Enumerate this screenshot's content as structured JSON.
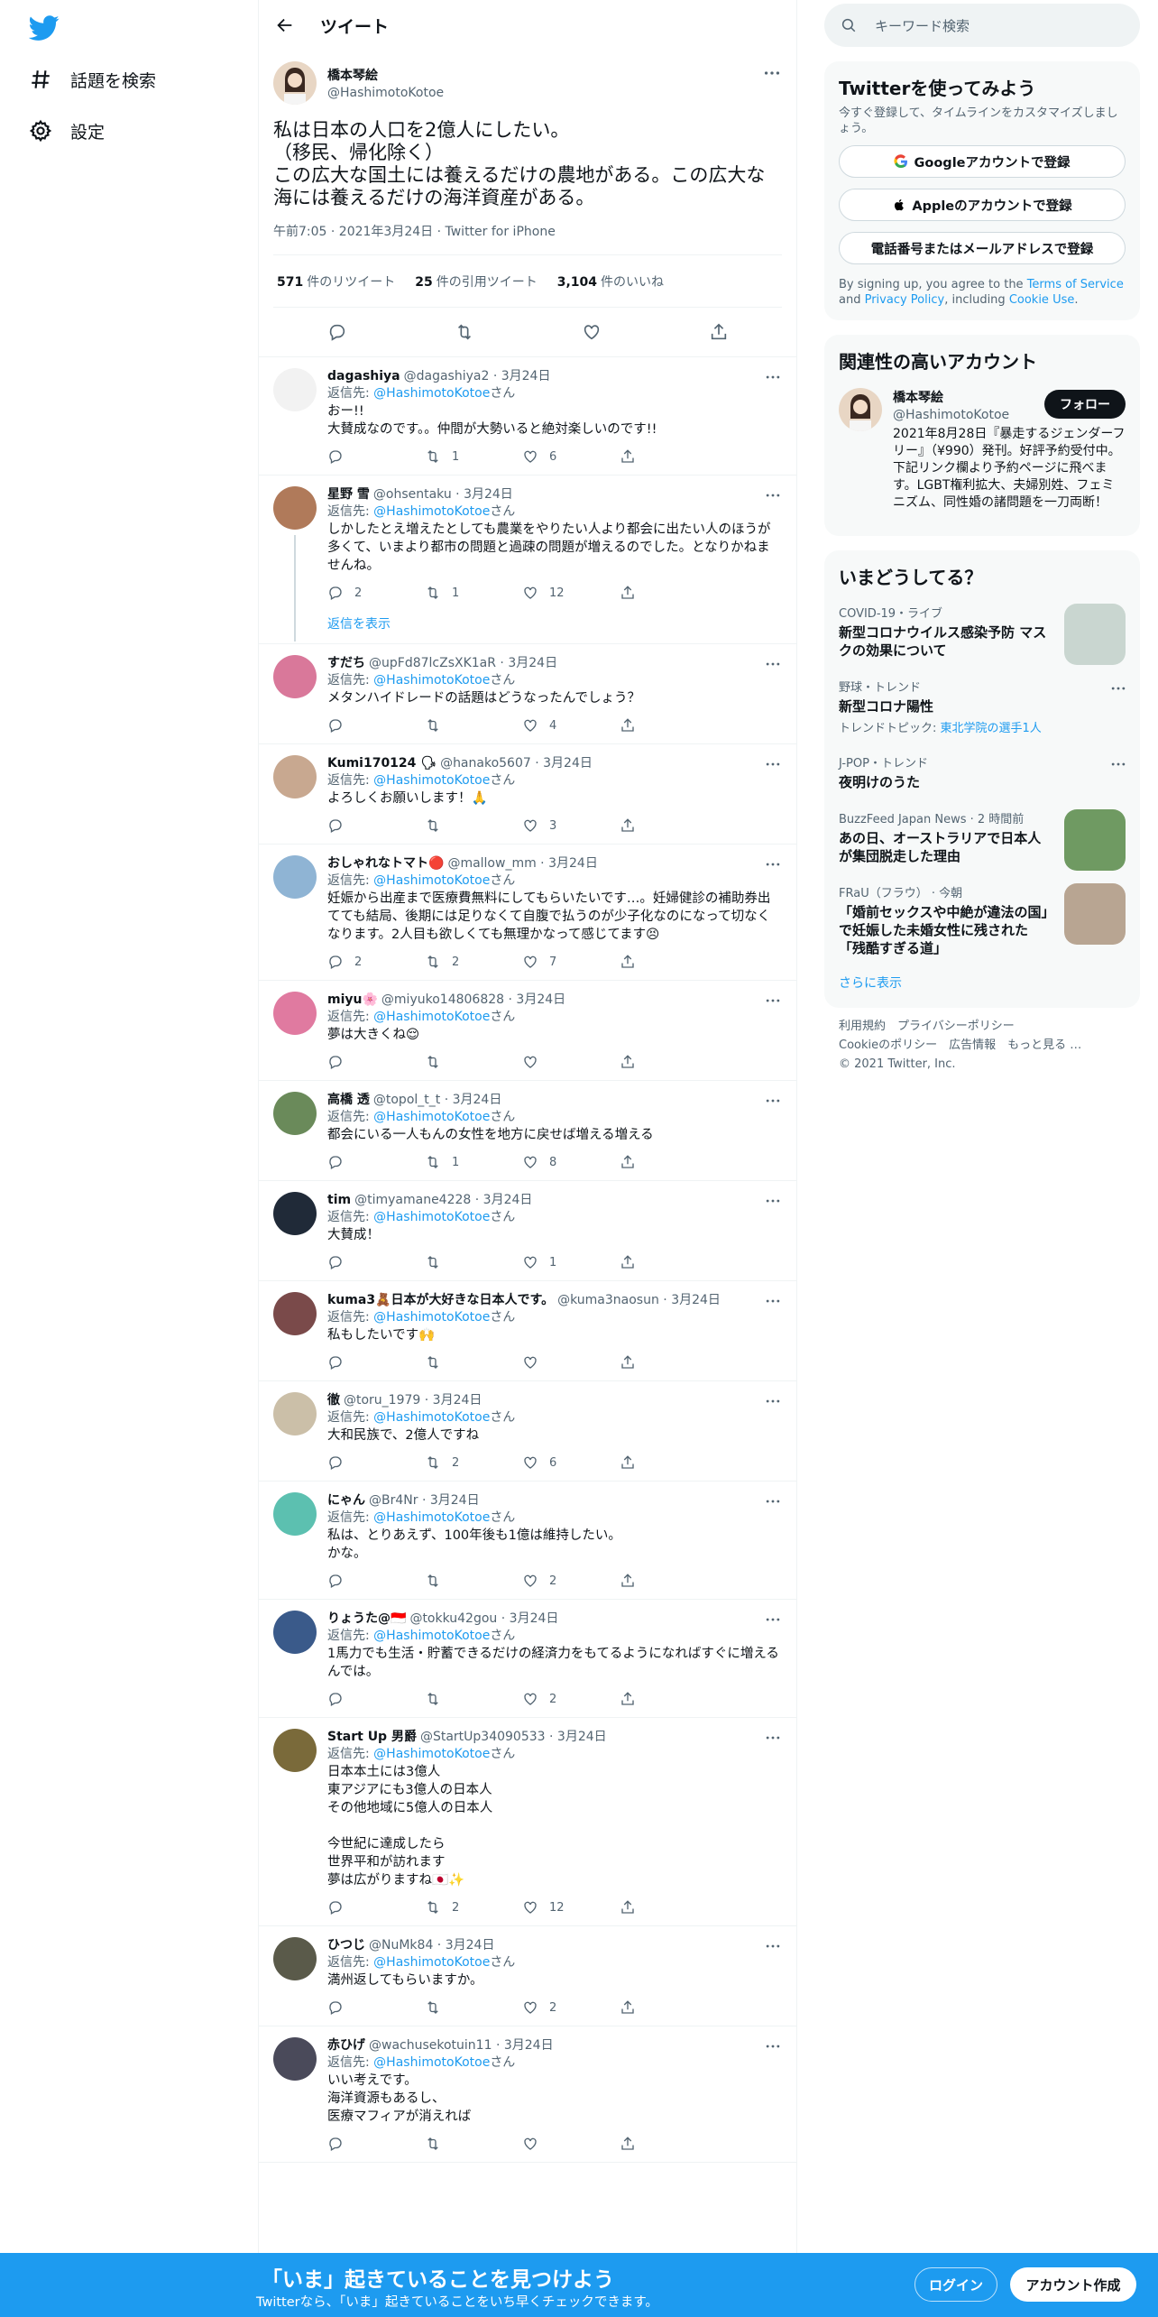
{
  "nav": {
    "explore": "話題を検索",
    "settings": "設定"
  },
  "header": {
    "title": "ツイート"
  },
  "tweet": {
    "name": "橋本琴絵",
    "handle": "@HashimotoKotoe",
    "text": "私は日本の人口を2億人にしたい。\n（移民、帰化除く）\nこの広大な国土には養えるだけの農地がある。この広大な海には養えるだけの海洋資産がある。",
    "meta": "午前7:05 · 2021年3月24日 · Twitter for iPhone",
    "retweets": "571",
    "retweets_label": "件のリツイート",
    "quotes": "25",
    "quotes_label": "件の引用ツイート",
    "likes": "3,104",
    "likes_label": "件のいいね"
  },
  "reply_prefix": "返信先: ",
  "reply_suffix": "さん",
  "show_replies": "返信を表示",
  "replies": [
    {
      "name": "dagashiya",
      "handle": "@dagashiya2",
      "date": "3月24日",
      "to": "@HashimotoKotoe",
      "text": "おー!!\n大賛成なのです。。仲間が大勢いると絶対楽しいのです!!",
      "reply": "",
      "rt": "1",
      "like": "6",
      "avatar": "#f2f2f2"
    },
    {
      "name": "星野 雪",
      "handle": "@ohsentaku",
      "date": "3月24日",
      "to": "@HashimotoKotoe",
      "text": "しかしたとえ増えたとしても農業をやりたい人より都会に出たい人のほうが多くて、いまより都市の問題と過疎の問題が増えるのでした。となりかねませんね。",
      "reply": "2",
      "rt": "1",
      "like": "12",
      "avatar": "#b07a5a"
    },
    {
      "name": "すだち",
      "handle": "@upFd87lcZsXK1aR",
      "date": "3月24日",
      "to": "@HashimotoKotoe",
      "text": "メタンハイドレードの話題はどうなったんでしょう？",
      "reply": "",
      "rt": "",
      "like": "4",
      "avatar": "#d9789a"
    },
    {
      "name": "Kumi170124 🗣",
      "handle": "@hanako5607",
      "date": "3月24日",
      "to": "@HashimotoKotoe",
      "text": "よろしくお願いします！🙏",
      "reply": "",
      "rt": "",
      "like": "3",
      "avatar": "#c8a890"
    },
    {
      "name": "おしゃれなトマト🔴",
      "handle": "@mallow_mm",
      "date": "3月24日",
      "to": "@HashimotoKotoe",
      "text": "妊娠から出産まで医療費無料にしてもらいたいです…。妊婦健診の補助券出てても結局、後期には足りなくて自腹で払うのが少子化なのになって切なくなります。2人目も欲しくても無理かなって感じてます😣",
      "reply": "2",
      "rt": "2",
      "like": "7",
      "avatar": "#8fb4d4"
    },
    {
      "name": "miyu🌸",
      "handle": "@miyuko14806828",
      "date": "3月24日",
      "to": "@HashimotoKotoe",
      "text": "夢は大きくね😌",
      "reply": "",
      "rt": "",
      "like": "",
      "avatar": "#e07aa0"
    },
    {
      "name": "高橋 透",
      "handle": "@topol_t_t",
      "date": "3月24日",
      "to": "@HashimotoKotoe",
      "text": "都会にいる一人もんの女性を地方に戻せば増える増える",
      "reply": "",
      "rt": "1",
      "like": "8",
      "avatar": "#6a8a5a"
    },
    {
      "name": "tim",
      "handle": "@timyamane4228",
      "date": "3月24日",
      "to": "@HashimotoKotoe",
      "text": "大賛成！",
      "reply": "",
      "rt": "",
      "like": "1",
      "avatar": "#202a38"
    },
    {
      "name": "kuma3🧸日本が大好きな日本人です。",
      "handle": "@kuma3naosun",
      "date": "3月24日",
      "to": "@HashimotoKotoe",
      "text": "私もしたいです🙌",
      "reply": "",
      "rt": "",
      "like": "",
      "avatar": "#7a4a4a"
    },
    {
      "name": "徹",
      "handle": "@toru_1979",
      "date": "3月24日",
      "to": "@HashimotoKotoe",
      "text": "大和民族で、2億人ですね",
      "reply": "",
      "rt": "2",
      "like": "6",
      "avatar": "#cbbfa8"
    },
    {
      "name": "にゃん",
      "handle": "@Br4Nr",
      "date": "3月24日",
      "to": "@HashimotoKotoe",
      "text": "私は、とりあえず、100年後も1億は維持したい。\nかな。",
      "reply": "",
      "rt": "",
      "like": "2",
      "avatar": "#5cc0b0"
    },
    {
      "name": "りょうた@🇮🇩",
      "handle": "@tokku42gou",
      "date": "3月24日",
      "to": "@HashimotoKotoe",
      "text": "1馬力でも生活・貯蓄できるだけの経済力をもてるようになればすぐに増えるんでは。",
      "reply": "",
      "rt": "",
      "like": "2",
      "avatar": "#3a5a8a"
    },
    {
      "name": "Start Up 男爵",
      "handle": "@StartUp34090533",
      "date": "3月24日",
      "to": "@HashimotoKotoe",
      "text": "日本本土には3億人\n東アジアにも3億人の日本人\nその他地域に5億人の日本人\n\n今世紀に達成したら\n世界平和が訪れます\n夢は広がりますね🇯🇵✨",
      "reply": "",
      "rt": "2",
      "like": "12",
      "avatar": "#7a6a3a"
    },
    {
      "name": "ひつじ",
      "handle": "@NuMk84",
      "date": "3月24日",
      "to": "@HashimotoKotoe",
      "text": "満州返してもらいますか。",
      "reply": "",
      "rt": "",
      "like": "2",
      "avatar": "#5a5a4a"
    },
    {
      "name": "赤ひげ",
      "handle": "@wachusekotuin11",
      "date": "3月24日",
      "to": "@HashimotoKotoe",
      "text": "いい考えです。\n海洋資源もあるし、\n医療マフィアが消えれば",
      "reply": "",
      "rt": "",
      "like": "",
      "avatar": "#4a4a5a"
    }
  ],
  "search": {
    "placeholder": "キーワード検索"
  },
  "signup": {
    "title": "Twitterを使ってみよう",
    "desc": "今すぐ登録して、タイムラインをカスタマイズしましょう。",
    "google": "Googleアカウントで登録",
    "apple": "Appleのアカウントで登録",
    "phone": "電話番号またはメールアドレスで登録",
    "terms_pre": "By signing up, you agree to the ",
    "terms": "Terms of Service",
    "and": " and ",
    "privacy": "Privacy Policy",
    "including": ", including ",
    "cookie": "Cookie Use",
    "dot": "."
  },
  "related": {
    "title": "関連性の高いアカウント",
    "name": "橋本琴絵",
    "handle": "@HashimotoKotoe",
    "follow": "フォロー",
    "bio": "2021年8月28日『暴走するジェンダーフリー』（¥990）発刊。好評予約受付中。下記リンク欄より予約ページに飛べます。LGBT権利拡大、夫婦別姓、フェミニズム、同性婚の諸問題を一刀両断！"
  },
  "trends": {
    "title": "いまどうしてる？",
    "items": [
      {
        "cat": "COVID-19・ライブ",
        "title": "新型コロナウイルス感染予防 マスクの効果について"
      },
      {
        "cat": "野球・トレンド",
        "title": "新型コロナ陽性",
        "sub_pre": "トレンドトピック: ",
        "sub": "東北学院の選手1人"
      },
      {
        "cat": "J-POP・トレンド",
        "title": "夜明けのうた"
      },
      {
        "cat": "BuzzFeed Japan News",
        "time": "· 2 時間前",
        "title": "あの日、オーストラリアで日本人が集団脱走した理由"
      },
      {
        "cat": "FRaU（フラウ）",
        "time": "· 今朝",
        "title": "「婚前セックスや中絶が違法の国」で妊娠した未婚女性に残された「残酷すぎる道」"
      }
    ],
    "more": "さらに表示"
  },
  "footer": {
    "terms": "利用規約",
    "privacy": "プライバシーポリシー",
    "cookie": "Cookieのポリシー",
    "ads": "広告情報",
    "more": "もっと見る …",
    "copy": "© 2021 Twitter, Inc."
  },
  "bottom": {
    "title": "「いま」起きていることを見つけよう",
    "sub": "Twitterなら、「いま」起きていることをいち早くチェックできます。",
    "login": "ログイン",
    "signup": "アカウント作成"
  },
  "colors": {
    "accent": "#1d9bf0",
    "text": "#0f1419",
    "muted": "#536471"
  }
}
